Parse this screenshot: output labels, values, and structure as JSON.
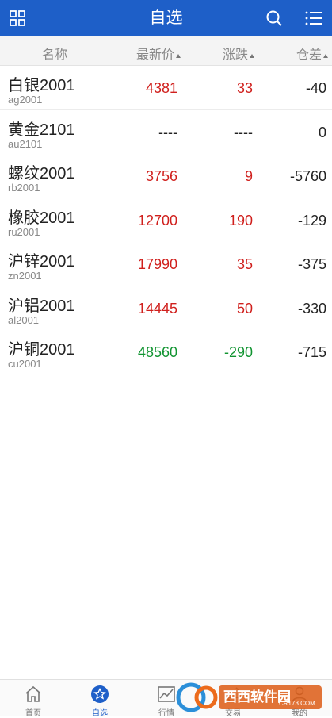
{
  "colors": {
    "accent": "#1e5fc8",
    "up": "#d0201d",
    "down": "#119431",
    "neutral": "#222222"
  },
  "header": {
    "title": "自选",
    "left_icon": "grid-menu-icon",
    "right_icons": [
      "search-icon",
      "list-menu-icon"
    ]
  },
  "columns": {
    "name": "名称",
    "price": "最新价",
    "change": "涨跌",
    "diff": "仓差"
  },
  "rows": [
    {
      "name": "白银2001",
      "code": "ag2001",
      "price": "4381",
      "change": "33",
      "diff": "-40",
      "trend": "up"
    },
    {
      "name": "黄金2101",
      "code": "au2101",
      "price": "----",
      "change": "----",
      "diff": "0",
      "trend": "flat"
    },
    {
      "name": "螺纹2001",
      "code": "rb2001",
      "price": "3756",
      "change": "9",
      "diff": "-5760",
      "trend": "up"
    },
    {
      "name": "橡胶2001",
      "code": "ru2001",
      "price": "12700",
      "change": "190",
      "diff": "-129",
      "trend": "up"
    },
    {
      "name": "沪锌2001",
      "code": "zn2001",
      "price": "17990",
      "change": "35",
      "diff": "-375",
      "trend": "up"
    },
    {
      "name": "沪铝2001",
      "code": "al2001",
      "price": "14445",
      "change": "50",
      "diff": "-330",
      "trend": "up"
    },
    {
      "name": "沪铜2001",
      "code": "cu2001",
      "price": "48560",
      "change": "-290",
      "diff": "-715",
      "trend": "down"
    }
  ],
  "tabs": [
    {
      "label": "首页",
      "icon": "home-icon",
      "active": false
    },
    {
      "label": "自选",
      "icon": "star-icon",
      "active": true
    },
    {
      "label": "行情",
      "icon": "chart-icon",
      "active": false
    },
    {
      "label": "交易",
      "icon": "trade-icon",
      "active": false
    },
    {
      "label": "我的",
      "icon": "user-icon",
      "active": false
    }
  ],
  "watermark": {
    "brand": "西西软件园",
    "site": "CR173.COM"
  }
}
